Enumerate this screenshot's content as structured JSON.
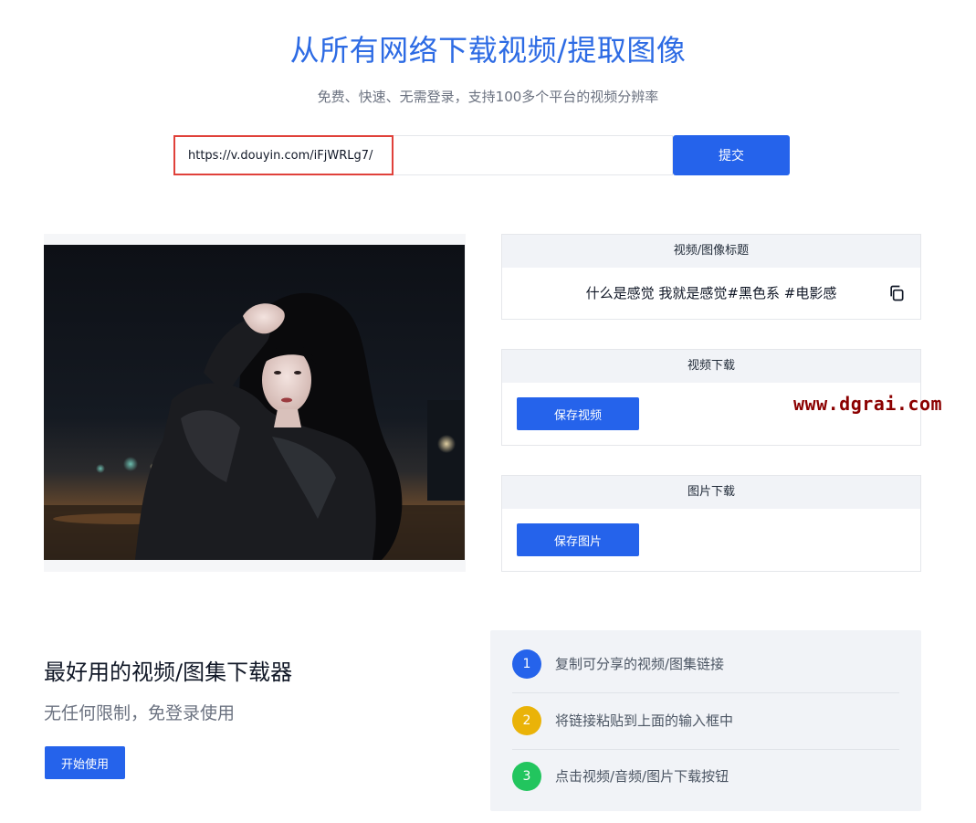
{
  "hero": {
    "title": "从所有网络下载视频/提取图像",
    "subtitle": "免费、快速、无需登录，支持100多个平台的视频分辨率"
  },
  "search": {
    "value": "https://v.douyin.com/iFjWRLg7/",
    "submit_label": "提交"
  },
  "result": {
    "title_card": {
      "header": "视频/图像标题",
      "text": "什么是感觉 我就是感觉#黑色系 #电影感",
      "copy_icon": "copy-icon"
    },
    "video_card": {
      "header": "视频下载",
      "button": "保存视频"
    },
    "image_card": {
      "header": "图片下载",
      "button": "保存图片"
    }
  },
  "watermark": "www.dgrai.com",
  "promo": {
    "title": "最好用的视频/图集下载器",
    "subtitle": "无任何限制，免登录使用",
    "start_label": "开始使用"
  },
  "steps": [
    {
      "num": "1",
      "text": "复制可分享的视频/图集链接",
      "color": "#2563eb"
    },
    {
      "num": "2",
      "text": "将链接粘贴到上面的输入框中",
      "color": "#eab308"
    },
    {
      "num": "3",
      "text": "点击视频/音频/图片下载按钮",
      "color": "#22c55e"
    }
  ],
  "colors": {
    "accent": "#2563eb",
    "title": "#2d6be4",
    "highlight": "#e0413a"
  }
}
